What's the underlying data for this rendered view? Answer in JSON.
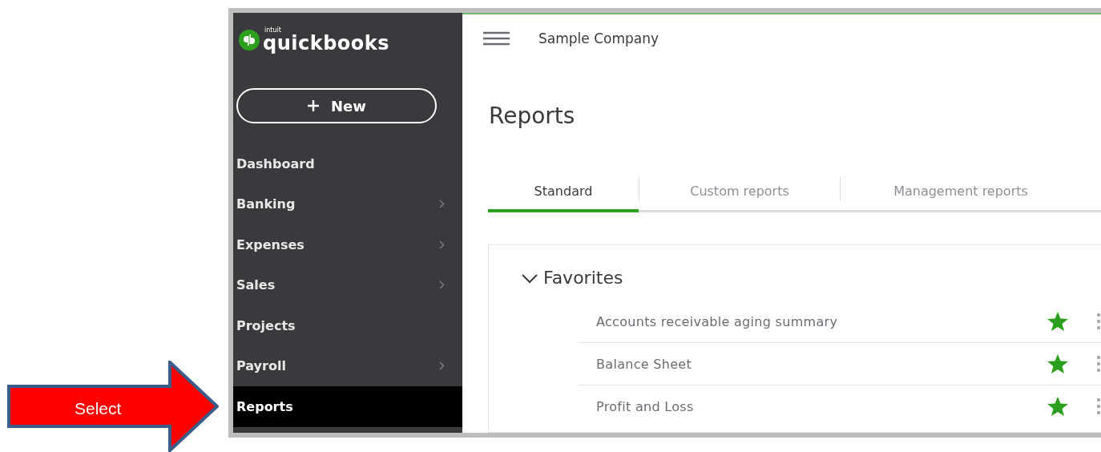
{
  "annotation": {
    "label": "Select"
  },
  "logo": {
    "brand": "intuit",
    "name": "quickbooks"
  },
  "new_button": {
    "label": "New"
  },
  "sidebar": {
    "items": [
      {
        "label": "Dashboard",
        "submenu": false,
        "selected": false
      },
      {
        "label": "Banking",
        "submenu": true,
        "selected": false
      },
      {
        "label": "Expenses",
        "submenu": true,
        "selected": false
      },
      {
        "label": "Sales",
        "submenu": true,
        "selected": false
      },
      {
        "label": "Projects",
        "submenu": false,
        "selected": false
      },
      {
        "label": "Payroll",
        "submenu": true,
        "selected": false
      },
      {
        "label": "Reports",
        "submenu": false,
        "selected": true
      }
    ]
  },
  "header": {
    "company": "Sample Company"
  },
  "page_title": "Reports",
  "tabs": [
    {
      "label": "Standard",
      "selected": true
    },
    {
      "label": "Custom reports",
      "selected": false
    },
    {
      "label": "Management reports",
      "selected": false
    }
  ],
  "favorites": {
    "title": "Favorites",
    "expanded": true,
    "rows": [
      {
        "label": "Accounts receivable aging summary",
        "starred": true
      },
      {
        "label": "Balance Sheet",
        "starred": true
      },
      {
        "label": "Profit and Loss",
        "starred": true
      }
    ]
  }
}
